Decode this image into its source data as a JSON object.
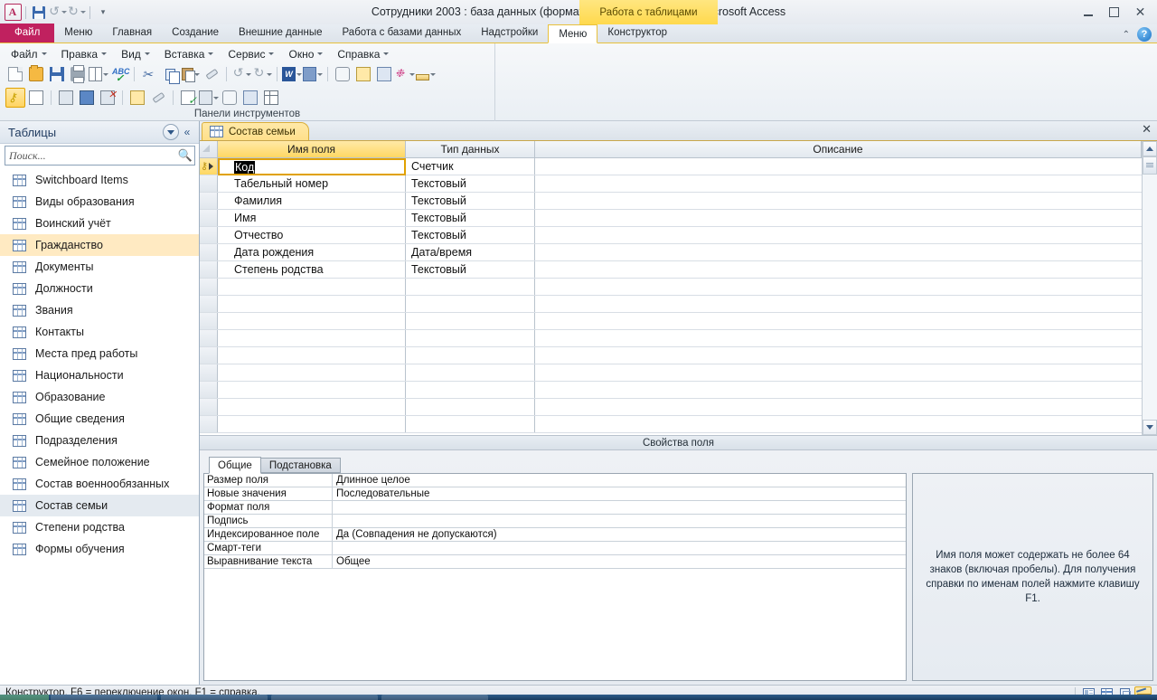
{
  "window": {
    "title": "Сотрудники 2003 : база данных (формат Access 2002 - 2003)  -  Microsoft Access",
    "contextual_tab_group": "Работа с таблицами",
    "minimize": "–",
    "maximize": "□",
    "close": "✕"
  },
  "quick_access": {
    "app_icon": "A",
    "save": "save-icon",
    "undo": "↺",
    "redo": "↻",
    "customize": "▾"
  },
  "ribbon": {
    "tabs": [
      {
        "label": "Файл",
        "type": "file"
      },
      {
        "label": "Меню",
        "type": "normal"
      },
      {
        "label": "Главная",
        "type": "normal"
      },
      {
        "label": "Создание",
        "type": "normal"
      },
      {
        "label": "Внешние данные",
        "type": "normal"
      },
      {
        "label": "Работа с базами данных",
        "type": "normal"
      },
      {
        "label": "Надстройки",
        "type": "normal"
      }
    ],
    "contextual_tabs": [
      {
        "label": "Меню",
        "active": true
      },
      {
        "label": "Конструктор",
        "active": false
      }
    ],
    "collapse_icon": "⌃",
    "help_icon": "?"
  },
  "toolbar": {
    "group_label": "Панели инструментов",
    "menus": [
      "Файл",
      "Правка",
      "Вид",
      "Вставка",
      "Сервис",
      "Окно",
      "Справка"
    ],
    "row1_icons": [
      "new-document-icon",
      "open-folder-icon",
      "save-icon",
      "print-icon",
      "print-preview-icon",
      "spelling-check-icon",
      "cut-scissors-icon",
      "copy-icon",
      "paste-icon",
      "format-painter-icon",
      "undo-icon",
      "redo-icon",
      "office-links-word-icon",
      "analyze-icon",
      "relationships-icon",
      "object-dependencies-icon",
      "new-object-icon",
      "code-icon",
      "ruler-icon"
    ],
    "row2_icons": [
      "primary-key-icon",
      "properties-sheet-icon",
      "insert-rows-icon",
      "build-icon",
      "delete-rows-icon",
      "indexes-icon",
      "test-validation-icon",
      "lookup-wizard-icon",
      "datasheet-view-icon",
      "subdatasheet-icon",
      "table-icon",
      "relationships-small-icon"
    ]
  },
  "nav_pane": {
    "title": "Таблицы",
    "dropdown_icon": "▼",
    "collapse_icon": "«",
    "search_placeholder": "Поиск...",
    "search_value": "",
    "search_icon": "search-icon",
    "items": [
      {
        "label": "Switchboard Items",
        "state": "normal"
      },
      {
        "label": "Виды образования",
        "state": "normal"
      },
      {
        "label": "Воинский учёт",
        "state": "normal"
      },
      {
        "label": "Гражданство",
        "state": "hover"
      },
      {
        "label": "Документы",
        "state": "normal"
      },
      {
        "label": "Должности",
        "state": "normal"
      },
      {
        "label": "Звания",
        "state": "normal"
      },
      {
        "label": "Контакты",
        "state": "normal"
      },
      {
        "label": "Места пред работы",
        "state": "normal"
      },
      {
        "label": "Национальности",
        "state": "normal"
      },
      {
        "label": "Образование",
        "state": "normal"
      },
      {
        "label": "Общие сведения",
        "state": "normal"
      },
      {
        "label": "Подразделения",
        "state": "normal"
      },
      {
        "label": "Семейное положение",
        "state": "normal"
      },
      {
        "label": "Состав военнообязанных",
        "state": "normal"
      },
      {
        "label": "Состав семьи",
        "state": "selected"
      },
      {
        "label": "Степени родства",
        "state": "normal"
      },
      {
        "label": "Формы обучения",
        "state": "normal"
      }
    ]
  },
  "document": {
    "tab_label": "Состав семьи",
    "close_icon": "✕"
  },
  "design_grid": {
    "headers": {
      "field_name": "Имя поля",
      "data_type": "Тип данных",
      "description": "Описание"
    },
    "rows": [
      {
        "name": "Код",
        "type": "Счетчик",
        "description": "",
        "primary_key": true,
        "current": true,
        "editing": true
      },
      {
        "name": "Табельный номер",
        "type": "Текстовый",
        "description": "",
        "primary_key": false,
        "current": false
      },
      {
        "name": "Фамилия",
        "type": "Текстовый",
        "description": "",
        "primary_key": false,
        "current": false
      },
      {
        "name": "Имя",
        "type": "Текстовый",
        "description": "",
        "primary_key": false,
        "current": false
      },
      {
        "name": "Отчество",
        "type": "Текстовый",
        "description": "",
        "primary_key": false,
        "current": false
      },
      {
        "name": "Дата рождения",
        "type": "Дата/время",
        "description": "",
        "primary_key": false,
        "current": false
      },
      {
        "name": "Степень родства",
        "type": "Текстовый",
        "description": "",
        "primary_key": false,
        "current": false
      }
    ],
    "blank_row_count": 9,
    "scroll_up_icon": "▲",
    "scroll_down_icon": "▼"
  },
  "properties": {
    "band_title": "Свойства поля",
    "tabs": [
      {
        "label": "Общие",
        "active": true
      },
      {
        "label": "Подстановка",
        "active": false
      }
    ],
    "rows": [
      {
        "key": "Размер поля",
        "value": "Длинное целое"
      },
      {
        "key": "Новые значения",
        "value": "Последовательные"
      },
      {
        "key": "Формат поля",
        "value": ""
      },
      {
        "key": "Подпись",
        "value": ""
      },
      {
        "key": "Индексированное поле",
        "value": "Да (Совпадения не допускаются)"
      },
      {
        "key": "Смарт-теги",
        "value": ""
      },
      {
        "key": "Выравнивание текста",
        "value": "Общее"
      }
    ],
    "help_text": "Имя поля может содержать не более 64 знаков (включая пробелы). Для получения справки по именам полей нажмите клавишу F1."
  },
  "status_bar": {
    "text": "Конструктор.  F6 = переключение окон.  F1 = справка.",
    "view_buttons": [
      {
        "name": "datasheet-view-button",
        "active": false
      },
      {
        "name": "pivot-table-view-button",
        "active": false
      },
      {
        "name": "pivot-chart-view-button",
        "active": false
      },
      {
        "name": "design-view-button",
        "active": true
      }
    ]
  },
  "colors": {
    "accent_red": "#c0215f",
    "contextual_yellow": "#ffd94d",
    "selection_orange": "#ffeac2",
    "active_header": "#ffd863",
    "nav_title": "#1f3a5f"
  }
}
